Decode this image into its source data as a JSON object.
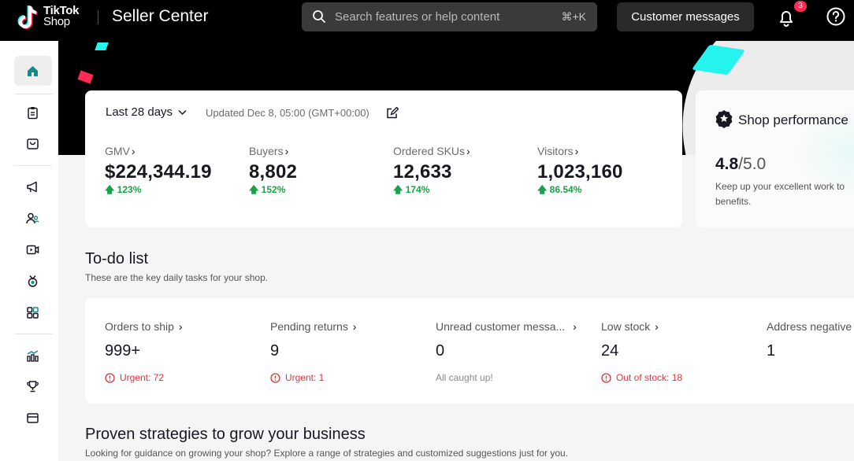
{
  "header": {
    "logo_line1": "TikTok",
    "logo_line2": "Shop",
    "app_title": "Seller Center",
    "search_placeholder": "Search features or help content",
    "search_shortcut": "⌘+K",
    "messages_label": "Customer messages",
    "notification_count": "3",
    "icons": [
      "tiktok-logo",
      "search-icon",
      "bell-icon",
      "help-icon"
    ]
  },
  "sidebar": {
    "items": [
      {
        "icon": "home-icon",
        "active": true
      },
      {
        "icon": "clipboard-icon"
      },
      {
        "icon": "box-icon"
      },
      {
        "icon": "megaphone-icon"
      },
      {
        "icon": "users-icon"
      },
      {
        "icon": "video-icon"
      },
      {
        "icon": "medal-icon"
      },
      {
        "icon": "apps-icon"
      },
      {
        "icon": "analytics-icon"
      },
      {
        "icon": "trophy-icon"
      },
      {
        "icon": "card-icon"
      }
    ]
  },
  "stats": {
    "range_label": "Last 28 days",
    "updated": "Updated Dec 8, 05:00 (GMT+00:00)",
    "metrics": [
      {
        "label": "GMV",
        "value": "$224,344.19",
        "change": "123%"
      },
      {
        "label": "Buyers",
        "value": "8,802",
        "change": "152%"
      },
      {
        "label": "Ordered SKUs",
        "value": "12,633",
        "change": "174%"
      },
      {
        "label": "Visitors",
        "value": "1,023,160",
        "change": "86.54%"
      }
    ]
  },
  "performance": {
    "title": "Shop performance",
    "score": "4.8",
    "max": "/5.0",
    "description": "Keep up your excellent work to benefits."
  },
  "todo": {
    "title": "To-do list",
    "subtitle": "These are the key daily tasks for your shop.",
    "tasks": [
      {
        "label": "Orders to ship",
        "value": "999+",
        "note": "Urgent: 72",
        "note_type": "urgent"
      },
      {
        "label": "Pending returns",
        "value": "9",
        "note": "Urgent: 1",
        "note_type": "urgent"
      },
      {
        "label": "Unread customer messa...",
        "value": "0",
        "note": "All caught up!",
        "note_type": "info"
      },
      {
        "label": "Low stock",
        "value": "24",
        "note": "Out of stock: 18",
        "note_type": "urgent"
      },
      {
        "label": "Address negative",
        "value": "1",
        "note": "",
        "note_type": "none"
      }
    ]
  },
  "strategies": {
    "title": "Proven strategies to grow your business",
    "subtitle": "Looking for guidance on growing your shop? Explore a range of strategies and customized suggestions just for you."
  },
  "colors": {
    "brand_cyan": "#25f4ee",
    "brand_red": "#fe2c55",
    "positive": "#1aa14a",
    "urgent": "#e0333f"
  }
}
